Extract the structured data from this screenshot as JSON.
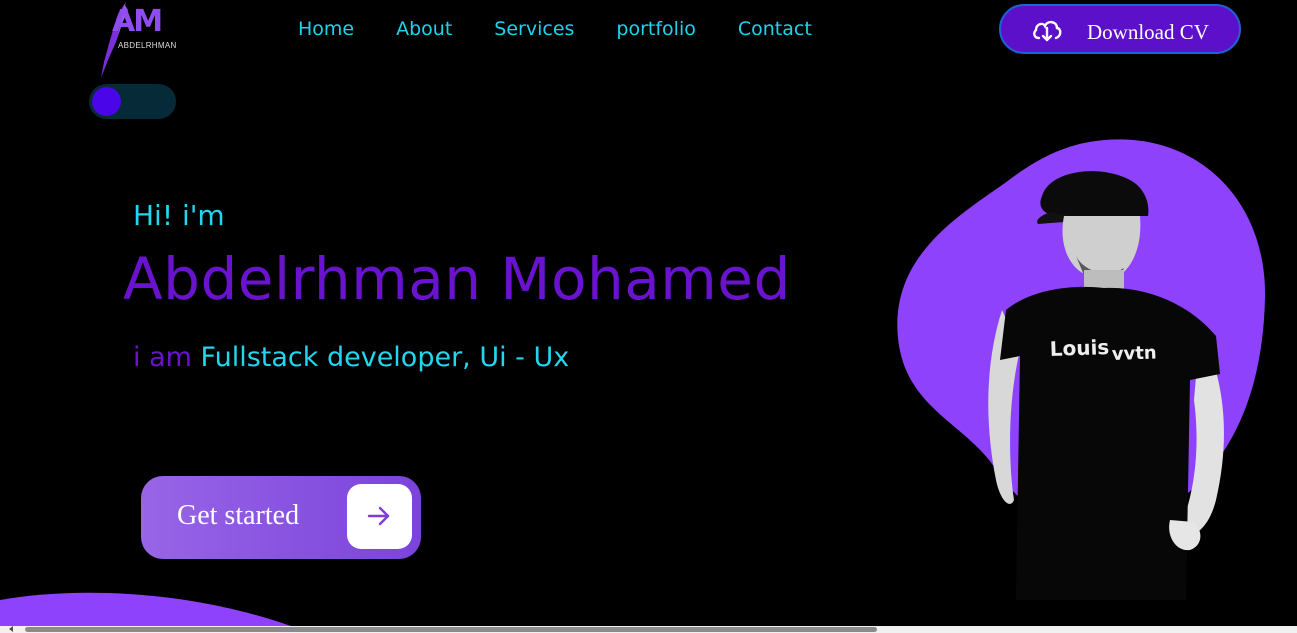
{
  "logo": {
    "mark": "AM",
    "subtitle": "ABDELRHMAN"
  },
  "nav": {
    "items": [
      "Home",
      "About",
      "Services",
      "portfolio",
      "Contact"
    ]
  },
  "header": {
    "download_cv_label": "Download CV"
  },
  "hero": {
    "greeting": "Hi! i'm",
    "name": "Abdelrhman Mohamed",
    "role_prefix": "i am",
    "role_title": "Fullstack developer, Ui - Ux",
    "cta_label": "Get started"
  },
  "colors": {
    "accent_cyan": "#21d6ee",
    "accent_purple": "#6a13cf",
    "blob_purple": "#8f42fb",
    "button_purple": "#5d10c9",
    "background": "#000000"
  },
  "icons": {
    "download": "cloud-download-icon",
    "arrow": "arrow-right-icon"
  }
}
